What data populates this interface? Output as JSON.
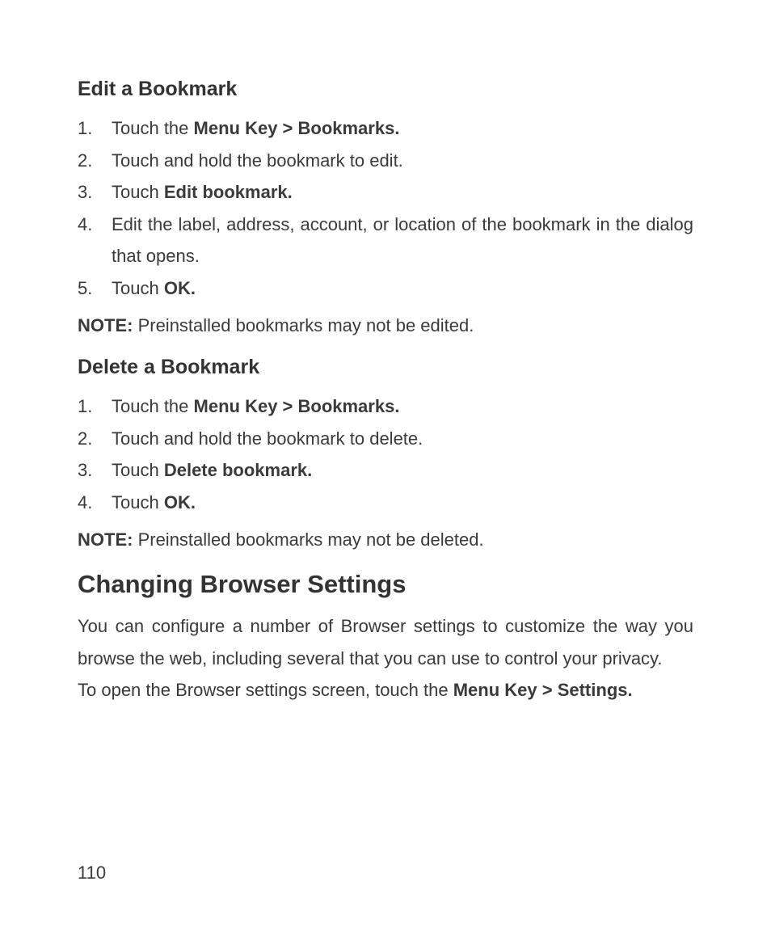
{
  "editBookmark": {
    "heading": "Edit a Bookmark",
    "steps": {
      "s1a": "Touch the ",
      "s1b": "Menu Key > Bookmarks.",
      "s2": "Touch and hold the bookmark to edit.",
      "s3a": "Touch ",
      "s3b": "Edit bookmark.",
      "s4": "Edit the label, address, account, or location of the bookmark in the dialog that opens.",
      "s5a": "Touch ",
      "s5b": "OK."
    },
    "noteLabel": "NOTE:",
    "noteText": " Preinstalled bookmarks may not be edited."
  },
  "deleteBookmark": {
    "heading": "Delete a Bookmark",
    "steps": {
      "s1a": "Touch the ",
      "s1b": "Menu Key > Bookmarks.",
      "s2": "Touch and hold the bookmark to delete.",
      "s3a": "Touch ",
      "s3b": "Delete bookmark.",
      "s4a": "Touch ",
      "s4b": "OK."
    },
    "noteLabel": "NOTE:",
    "noteText": " Preinstalled bookmarks may not be deleted."
  },
  "settings": {
    "heading": "Changing Browser Settings",
    "para1": "You can configure a number of Browser settings to customize the way you browse the web, including several that you can use to control your privacy.",
    "para2a": "To open the Browser settings screen, touch the ",
    "para2b": "Menu Key > Settings."
  },
  "pageNumber": "110"
}
